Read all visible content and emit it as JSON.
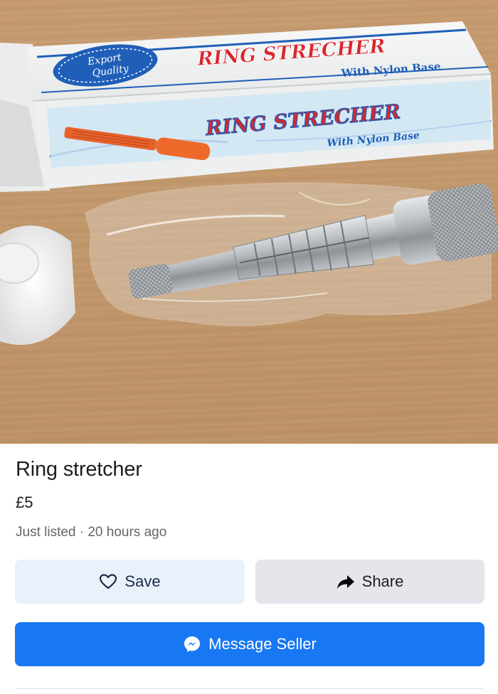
{
  "photo": {
    "box_badge": [
      "Export",
      "Quality"
    ],
    "box_title": "RING STRECHER",
    "box_subtitle": "With Nylon Base"
  },
  "listing": {
    "title": "Ring stretcher",
    "price": "£5",
    "meta": "Just listed · 20 hours ago"
  },
  "actions": {
    "save_label": "Save",
    "share_label": "Share",
    "message_label": "Message Seller"
  },
  "icons": {
    "save": "heart-outline-icon",
    "share": "share-arrow-icon",
    "message": "messenger-icon"
  },
  "colors": {
    "primary": "#1877f2",
    "save_bg": "#e9f1fb",
    "share_bg": "#e4e6eb",
    "box_title_red": "#d9262c",
    "box_blue": "#1f5fb8"
  }
}
